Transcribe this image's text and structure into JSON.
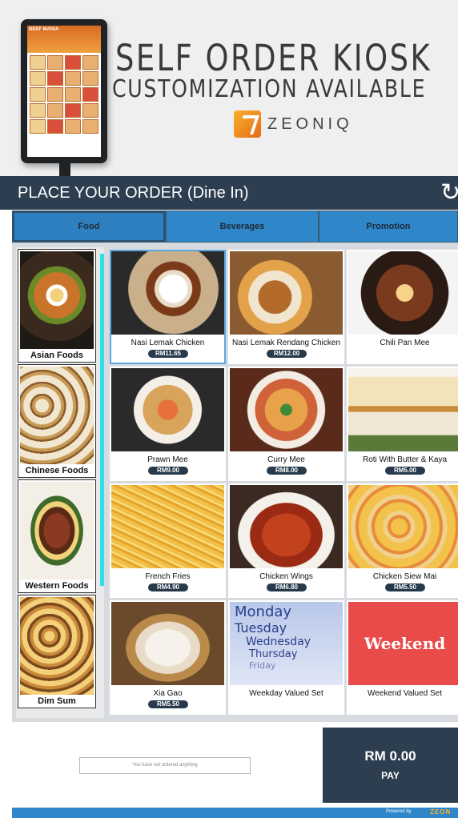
{
  "banner": {
    "title": "SELF ORDER KIOSK",
    "subtitle": "CUSTOMIZATION AVAILABLE",
    "brand_name": "ZEONIQ",
    "kiosk_screen_text": "BEEF MANIA"
  },
  "header": {
    "title": "PLACE YOUR ORDER (Dine In)",
    "refresh_icon": "refresh-icon"
  },
  "tabs": [
    {
      "label": "Food",
      "active": true
    },
    {
      "label": "Beverages",
      "active": false
    },
    {
      "label": "Promotion",
      "active": false
    }
  ],
  "categories": [
    {
      "label": "Asian Foods"
    },
    {
      "label": "Chinese Foods"
    },
    {
      "label": "Western Foods"
    },
    {
      "label": "Dim Sum"
    }
  ],
  "menu_items": [
    {
      "name": "Nasi Lemak Chicken",
      "price": "RM11.65",
      "selected": true
    },
    {
      "name": "Nasi Lemak Rendang Chicken",
      "price": "RM12.00"
    },
    {
      "name": "Chili Pan Mee",
      "price": ""
    },
    {
      "name": "Prawn Mee",
      "price": "RM9.00"
    },
    {
      "name": "Curry Mee",
      "price": "RM8.00"
    },
    {
      "name": "Roti With Butter & Kaya",
      "price": "RM5.00"
    },
    {
      "name": "French Fries",
      "price": "RM4.90"
    },
    {
      "name": "Chicken Wings",
      "price": "RM6.80"
    },
    {
      "name": "Chicken Siew Mai",
      "price": "RM5.50"
    },
    {
      "name": "Xia Gao",
      "price": "RM5.50"
    },
    {
      "name": "Weekday Valued Set",
      "price": ""
    },
    {
      "name": "Weekend Valued Set",
      "price": ""
    }
  ],
  "weekday_image_text": [
    "Monday",
    "Tuesday",
    "Wednesday",
    "Thursday",
    "Friday"
  ],
  "weekend_image_text": "Weekend",
  "order": {
    "empty_message": "You have not ordered anything",
    "total": "RM 0.00",
    "pay_label": "PAY"
  },
  "footer": {
    "powered_by": "Powered by",
    "brand": "ZEON"
  },
  "colors": {
    "header_bg": "#2c3e4f",
    "tab_bg": "#2f86c8",
    "scroll_accent": "#2de0e8",
    "weekend_red": "#e94a4a"
  }
}
